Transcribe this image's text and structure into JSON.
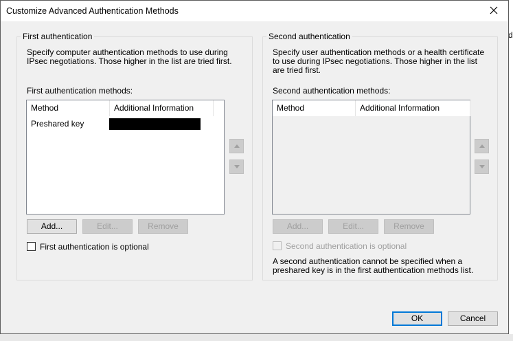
{
  "window": {
    "title": "Customize Advanced Authentication Methods"
  },
  "first": {
    "legend": "First authentication",
    "description": "Specify computer authentication methods to use during IPsec negotiations.  Those higher in the list are tried first.",
    "list_label": "First authentication methods:",
    "columns": [
      "Method",
      "Additional Information"
    ],
    "rows": [
      {
        "method": "Preshared key",
        "info_redacted": true
      }
    ],
    "buttons": {
      "add": "Add...",
      "edit": "Edit...",
      "remove": "Remove"
    },
    "optional_label": "First authentication is optional",
    "optional_checked": false
  },
  "second": {
    "legend": "Second authentication",
    "description": "Specify user authentication methods or a health certificate to use during IPsec negotiations.  Those higher in the list are tried first.",
    "list_label": "Second authentication methods:",
    "columns": [
      "Method",
      "Additional Information"
    ],
    "rows": [],
    "buttons": {
      "add": "Add...",
      "edit": "Edit...",
      "remove": "Remove"
    },
    "optional_label": "Second authentication is optional",
    "optional_checked": false,
    "note": "A second authentication cannot be specified when a preshared key is in the first authentication methods list."
  },
  "footer": {
    "ok": "OK",
    "cancel": "Cancel"
  },
  "background": {
    "edge_text": "de"
  }
}
